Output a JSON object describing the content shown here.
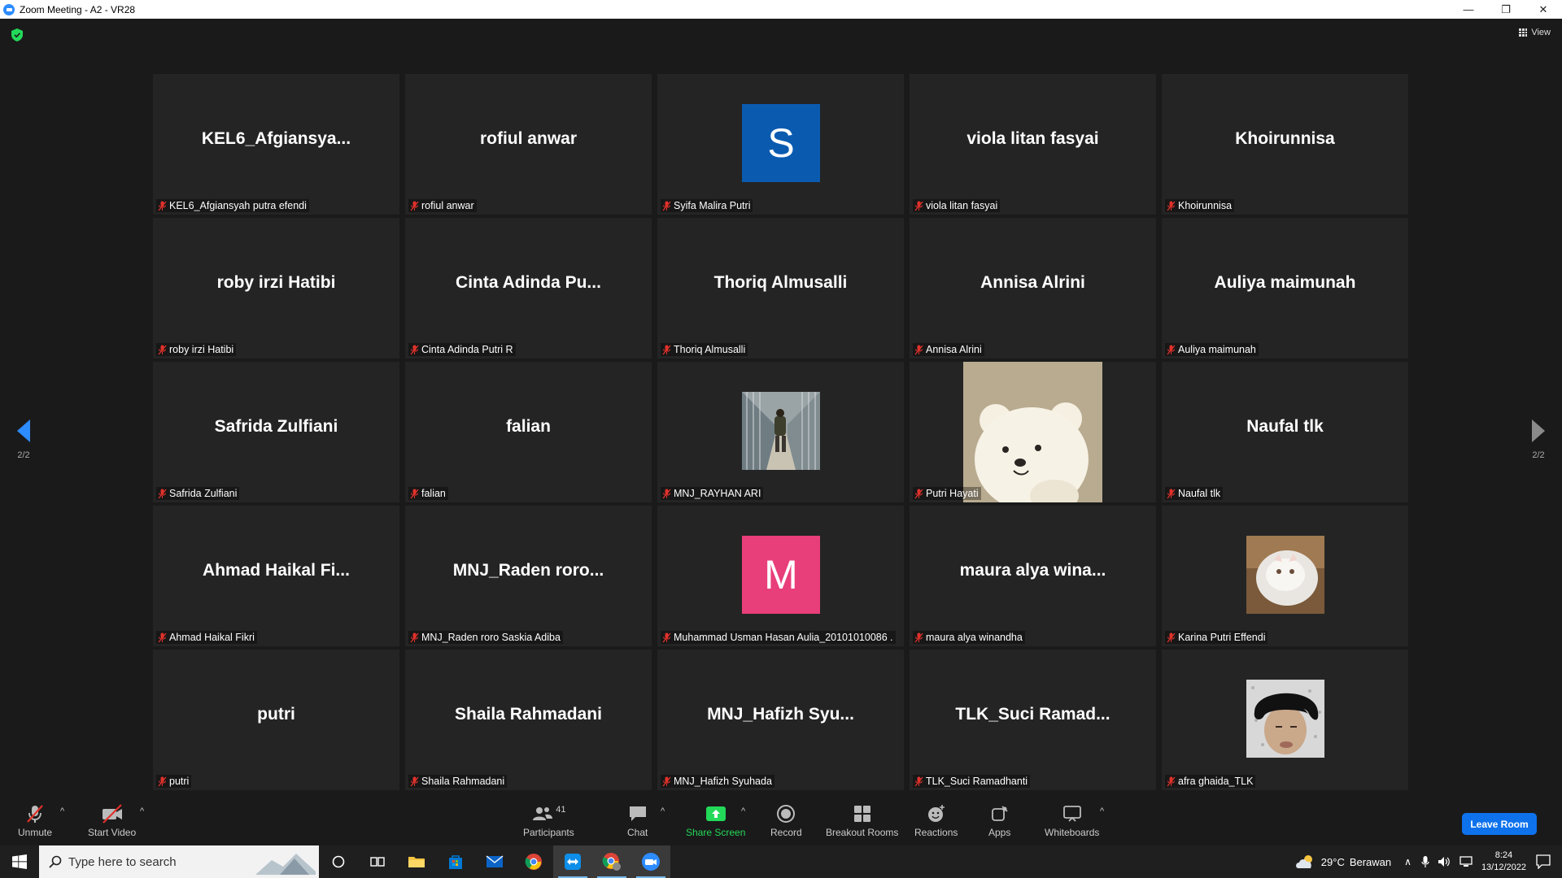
{
  "window": {
    "title": "Zoom Meeting - A2 - VR28",
    "minimize": "—",
    "restore": "❐",
    "close": "✕"
  },
  "meeting": {
    "view_label": "View",
    "page_indicator_left": "2/2",
    "page_indicator_right": "2/2"
  },
  "participants_grid": [
    {
      "display": "KEL6_Afgiansya...",
      "label": "KEL6_Afgiansyah putra efendi",
      "avatar": "name"
    },
    {
      "display": "rofiul anwar",
      "label": "rofiul anwar",
      "avatar": "name"
    },
    {
      "display": "S",
      "label": "Syifa Malira Putri",
      "avatar": "letter",
      "color": "#0a5bb0"
    },
    {
      "display": "viola litan fasyai",
      "label": "viola litan fasyai",
      "avatar": "name"
    },
    {
      "display": "Khoirunnisa",
      "label": "Khoirunnisa",
      "avatar": "name"
    },
    {
      "display": "roby irzi Hatibi",
      "label": "roby irzi Hatibi",
      "avatar": "name"
    },
    {
      "display": "Cinta Adinda Pu...",
      "label": "Cinta Adinda Putri R",
      "avatar": "name"
    },
    {
      "display": "Thoriq Almusalli",
      "label": "Thoriq Almusalli",
      "avatar": "name"
    },
    {
      "display": "Annisa Alrini",
      "label": "Annisa Alrini",
      "avatar": "name"
    },
    {
      "display": "Auliya maimunah",
      "label": "Auliya maimunah",
      "avatar": "name"
    },
    {
      "display": "Safrida Zulfiani",
      "label": "Safrida Zulfiani",
      "avatar": "name"
    },
    {
      "display": "falian",
      "label": "falian",
      "avatar": "name"
    },
    {
      "display": "",
      "label": "MNJ_RAYHAN ARI",
      "avatar": "photo-walkway"
    },
    {
      "display": "",
      "label": "Putri Hayati",
      "avatar": "photo-bear"
    },
    {
      "display": "Naufal tlk",
      "label": "Naufal tlk",
      "avatar": "name"
    },
    {
      "display": "Ahmad Haikal Fi...",
      "label": "Ahmad Haikal Fikri",
      "avatar": "name"
    },
    {
      "display": "MNJ_Raden roro...",
      "label": "MNJ_Raden roro Saskia Adiba",
      "avatar": "name"
    },
    {
      "display": "M",
      "label": "Muhammad Usman Hasan Aulia_20101010086 .",
      "avatar": "letter",
      "color": "#e83e7a"
    },
    {
      "display": "maura alya wina...",
      "label": "maura alya winandha",
      "avatar": "name"
    },
    {
      "display": "",
      "label": "Karina Putri Effendi",
      "avatar": "photo-cat"
    },
    {
      "display": "putri",
      "label": "putri",
      "avatar": "name"
    },
    {
      "display": "Shaila Rahmadani",
      "label": "Shaila Rahmadani",
      "avatar": "name"
    },
    {
      "display": "MNJ_Hafizh Syu...",
      "label": "MNJ_Hafizh Syuhada",
      "avatar": "name"
    },
    {
      "display": "TLK_Suci Ramad...",
      "label": "TLK_Suci Ramadhanti",
      "avatar": "name"
    },
    {
      "display": "",
      "label": "afra ghaida_TLK",
      "avatar": "photo-person"
    }
  ],
  "toolbar": {
    "unmute": "Unmute",
    "start_video": "Start Video",
    "participants": "Participants",
    "participants_count": "41",
    "chat": "Chat",
    "share_screen": "Share Screen",
    "record": "Record",
    "breakout_rooms": "Breakout Rooms",
    "reactions": "Reactions",
    "apps": "Apps",
    "whiteboards": "Whiteboards",
    "leave_room": "Leave Room",
    "caret": "^"
  },
  "taskbar": {
    "search_placeholder": "Type here to search",
    "weather_temp": "29°C",
    "weather_desc": "Berawan",
    "time": "8:24",
    "date": "13/12/2022"
  },
  "colors": {
    "accent_blue": "#0e72ed",
    "share_green": "#23d959",
    "muted_red": "#e0312b"
  }
}
